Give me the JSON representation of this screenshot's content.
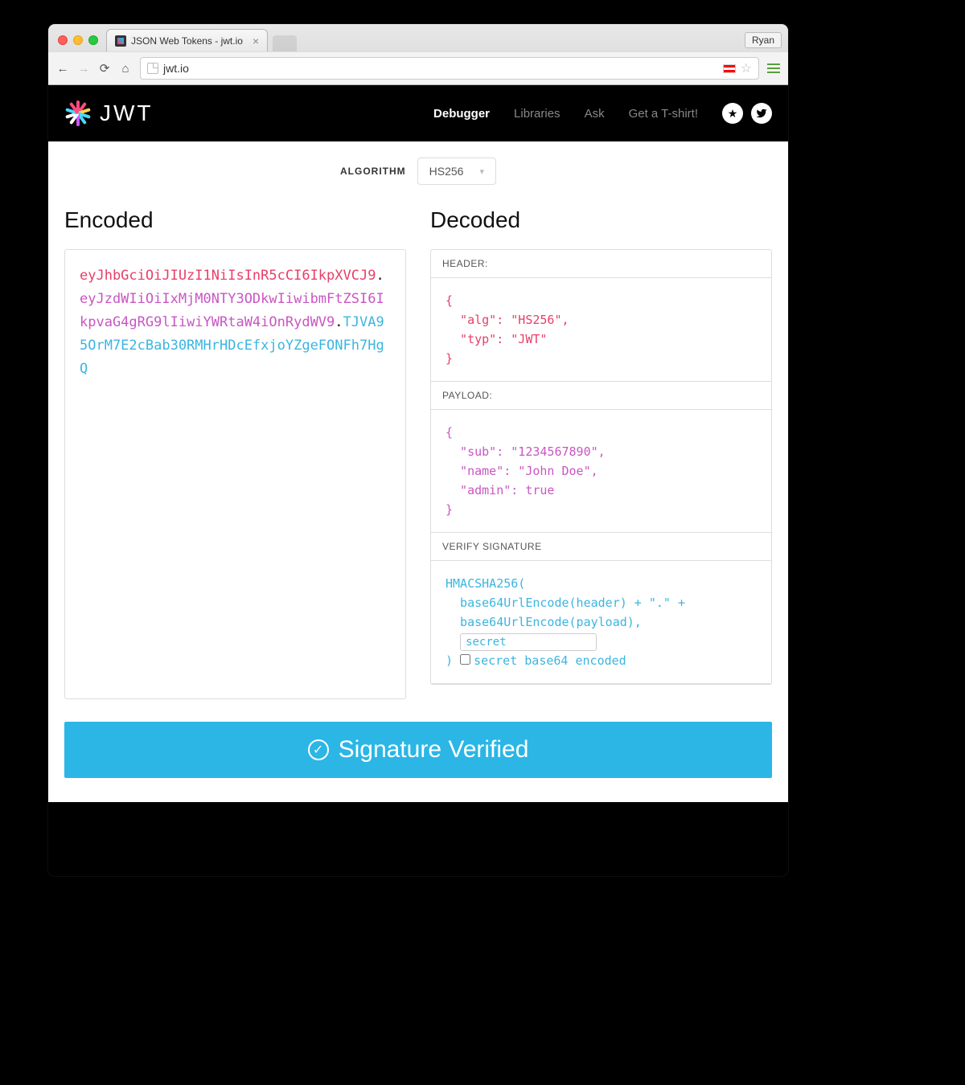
{
  "browser": {
    "tab_title": "JSON Web Tokens - jwt.io",
    "url": "jwt.io",
    "profile": "Ryan"
  },
  "nav": {
    "brand": "JWT",
    "links": [
      "Debugger",
      "Libraries",
      "Ask",
      "Get a T-shirt!"
    ],
    "active": "Debugger"
  },
  "algorithm": {
    "label": "ALGORITHM",
    "value": "HS256"
  },
  "headings": {
    "encoded": "Encoded",
    "decoded": "Decoded"
  },
  "encoded": {
    "header": "eyJhbGciOiJIUzI1NiIsInR5cCI6IkpXVCJ9",
    "payload": "eyJzdWIiOiIxMjM0NTY3ODkwIiwibmFtZSI6IkpvaG4gRG9lIiwiYWRtaW4iOnRydWV9",
    "signature": "TJVA95OrM7E2cBab30RMHrHDcEfxjoYZgeFONFh7HgQ"
  },
  "decoded": {
    "header_title": "HEADER:",
    "payload_title": "PAYLOAD:",
    "signature_title": "VERIFY SIGNATURE",
    "header_json": "{\n  \"alg\": \"HS256\",\n  \"typ\": \"JWT\"\n}",
    "payload_json": "{\n  \"sub\": \"1234567890\",\n  \"name\": \"John Doe\",\n  \"admin\": true\n}",
    "sig_line1": "HMACSHA256(",
    "sig_line2": "  base64UrlEncode(header) + \".\" +",
    "sig_line3": "  base64UrlEncode(payload),",
    "sig_close": ") ",
    "secret_value": "secret",
    "secret_checkbox_label": "secret base64 encoded"
  },
  "banner": "Signature Verified"
}
